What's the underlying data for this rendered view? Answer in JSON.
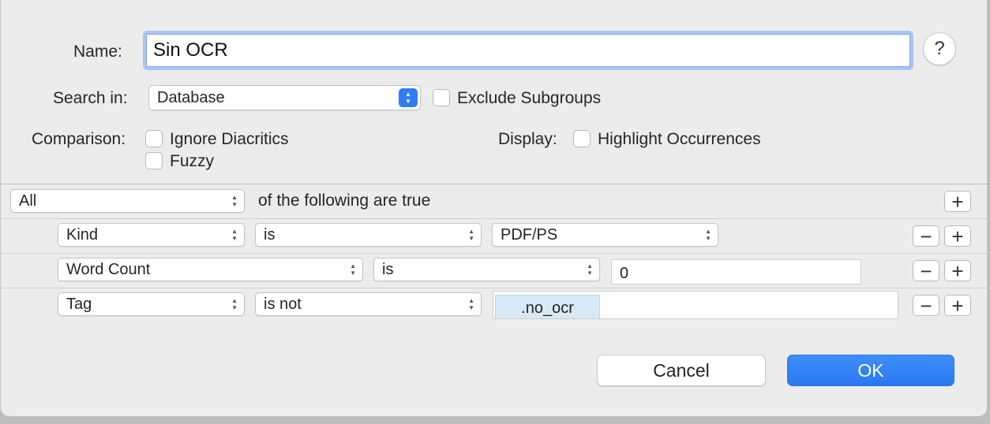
{
  "form": {
    "name_label": "Name:",
    "name_value": "Sin OCR",
    "help_label": "?",
    "search_in_label": "Search in:",
    "search_in_value": "Database",
    "exclude_subgroups_label": "Exclude Subgroups",
    "comparison_label": "Comparison:",
    "ignore_diacritics_label": "Ignore Diacritics",
    "fuzzy_label": "Fuzzy",
    "display_label": "Display:",
    "highlight_occurrences_label": "Highlight Occurrences"
  },
  "rules": {
    "match_value": "All",
    "match_suffix": "of the following are true",
    "rows": [
      {
        "field": "Kind",
        "operator": "is",
        "value": "PDF/PS"
      },
      {
        "field": "Word Count",
        "operator": "is",
        "value": "0"
      },
      {
        "field": "Tag",
        "operator": "is not",
        "value": ".no_ocr"
      }
    ]
  },
  "icons": {
    "plus": "+",
    "minus": "−",
    "up": "▲",
    "down": "▼"
  },
  "buttons": {
    "cancel_label": "Cancel",
    "ok_label": "OK"
  },
  "colors": {
    "accent": "#2f7df6",
    "token_bg": "#d6e9f5",
    "selection": "#b3d3f7"
  }
}
